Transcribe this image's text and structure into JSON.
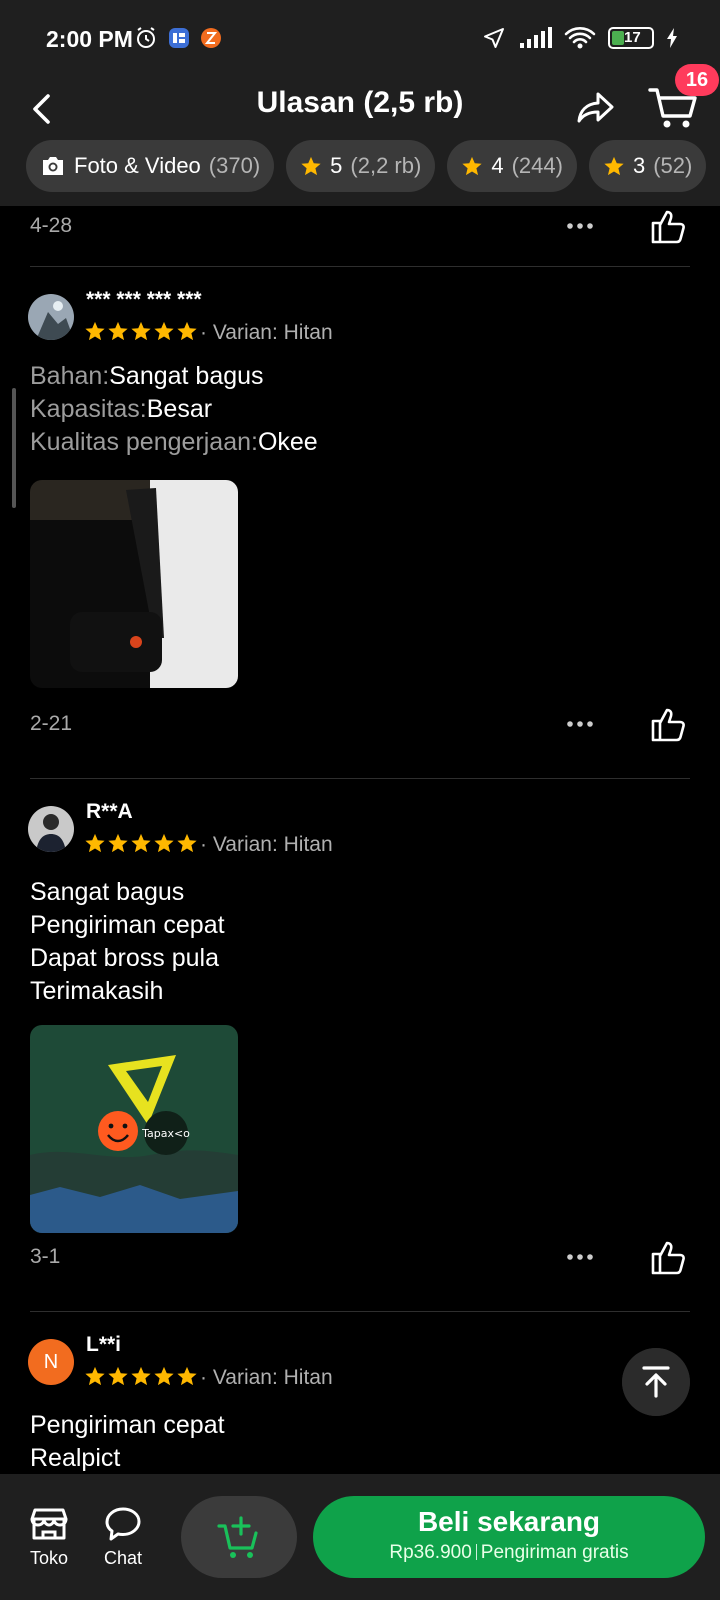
{
  "status_bar": {
    "time": "2:00 PM",
    "battery": "17"
  },
  "header": {
    "title": "Ulasan (2,5 rb)",
    "cart_badge": "16"
  },
  "filters": [
    {
      "label": "Foto & Video",
      "count": "(370)",
      "icon": "camera-icon"
    },
    {
      "label": "5",
      "count": "(2,2 rb)",
      "icon": "star-icon"
    },
    {
      "label": "4",
      "count": "(244)",
      "icon": "star-icon"
    },
    {
      "label": "3",
      "count": "(52)",
      "icon": "star-icon"
    }
  ],
  "reviews": [
    {
      "date": "4-28"
    },
    {
      "name": "*** *** *** ***",
      "rating": 5,
      "variant": "Varian: Hitan",
      "lines": [
        {
          "key": "Bahan:",
          "value": "Sangat bagus"
        },
        {
          "key": "Kapasitas:",
          "value": "Besar"
        },
        {
          "key": "Kualitas pengerjaan:",
          "value": "Okee"
        }
      ],
      "date": "2-21"
    },
    {
      "name": "R**A",
      "rating": 5,
      "variant": "Varian: Hitan",
      "lines": [
        "Sangat bagus",
        "Pengiriman cepat",
        "Dapat bross pula",
        "Terimakasih"
      ],
      "photo_text": "Tapax<o",
      "date": "3-1"
    },
    {
      "name": "L**i",
      "avatar_letter": "N",
      "rating": 5,
      "variant": "Varian: Hitan",
      "lines": [
        "Pengiriman cepat",
        "Realpict"
      ]
    }
  ],
  "bottom_bar": {
    "store_label": "Toko",
    "chat_label": "Chat",
    "buy_label": "Beli sekarang",
    "price": "Rp36.900",
    "shipping": "Pengiriman gratis"
  },
  "colors": {
    "accent": "#0fa24a",
    "star": "#ffb800",
    "badge": "#ff3b5c"
  }
}
